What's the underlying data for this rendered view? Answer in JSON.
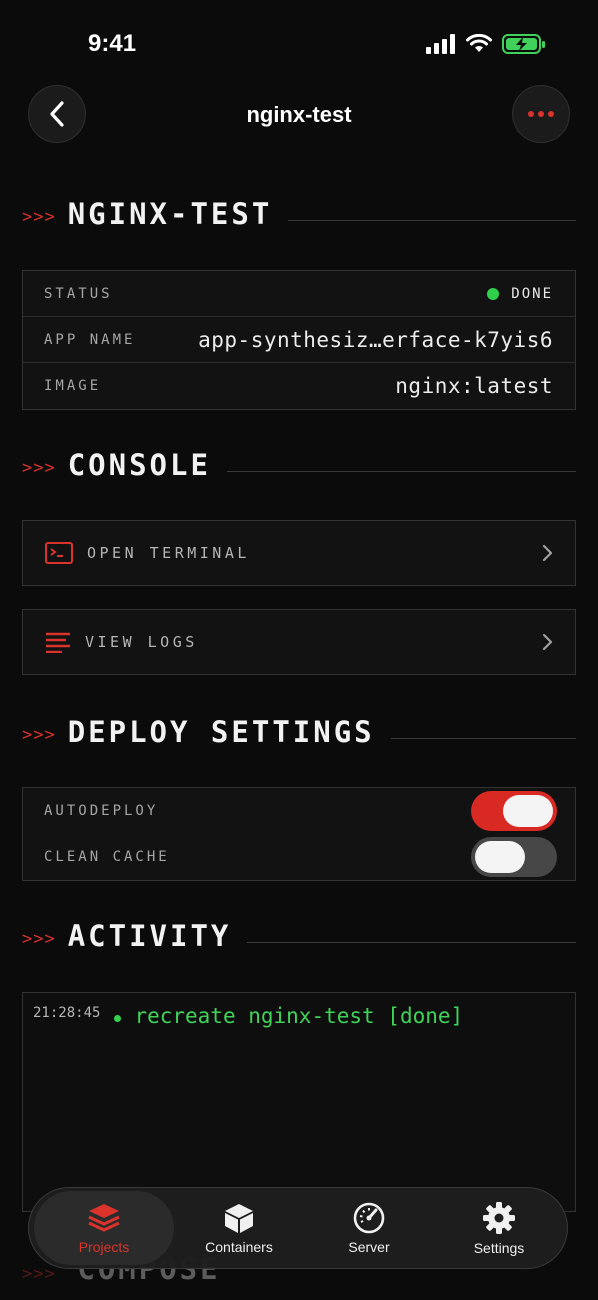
{
  "statusbar": {
    "time": "9:41"
  },
  "nav": {
    "title": "nginx-test"
  },
  "sections": {
    "project": "NGINX-TEST",
    "console": "CONSOLE",
    "deploy": "DEPLOY SETTINGS",
    "activity": "ACTIVITY",
    "next": "COMPOSE"
  },
  "chevron": ">>>",
  "info": {
    "status_label": "STATUS",
    "status_value": "DONE",
    "app_label": "APP NAME",
    "app_value": "app-synthesiz…erface-k7yis6",
    "image_label": "IMAGE",
    "image_value": "nginx:latest"
  },
  "console": {
    "terminal_label": "OPEN TERMINAL",
    "logs_label": "VIEW LOGS"
  },
  "deploy": {
    "autodeploy_label": "AUTODEPLOY",
    "autodeploy_on": true,
    "clean_cache_label": "CLEAN CACHE",
    "clean_cache_on": false
  },
  "activity": {
    "entries": [
      {
        "time": "21:28:45",
        "message": "recreate nginx-test [done]"
      }
    ]
  },
  "tabs": [
    {
      "label": "Projects",
      "icon": "layers-icon",
      "active": true
    },
    {
      "label": "Containers",
      "icon": "box-icon",
      "active": false
    },
    {
      "label": "Server",
      "icon": "gauge-icon",
      "active": false
    },
    {
      "label": "Settings",
      "icon": "gear-icon",
      "active": false
    }
  ],
  "colors": {
    "accent": "#d9332c",
    "success": "#2fd04a",
    "background": "#0b0b0b"
  }
}
